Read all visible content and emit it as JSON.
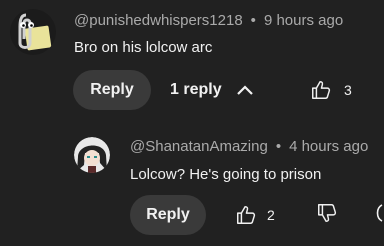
{
  "comment": {
    "author": "@punishedwhispers1218",
    "time": "9 hours ago",
    "text": "Bro on his lolcow arc",
    "reply_label": "Reply",
    "replies_label": "1 reply",
    "likes": "3"
  },
  "reply": {
    "author": "@ShanatanAmazing",
    "time": "4 hours ago",
    "text": "Lolcow?  He's going to prison",
    "reply_label": "Reply",
    "likes": "2"
  },
  "separator": "•"
}
